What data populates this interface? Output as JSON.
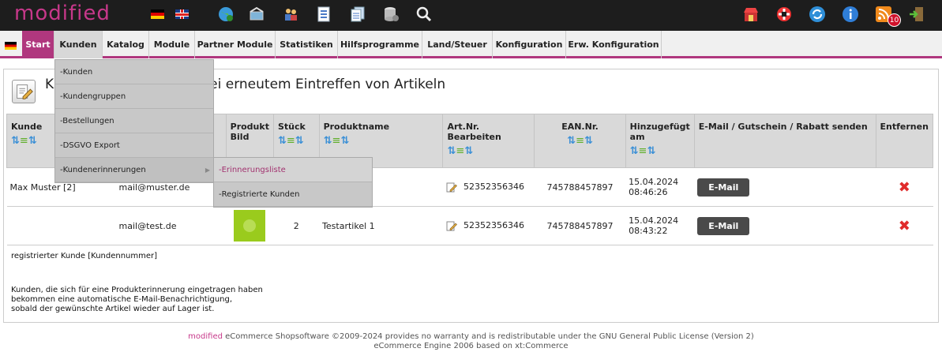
{
  "app": {
    "logo": "modified",
    "notification_count": "10"
  },
  "topbar_icons": [
    "globe-icon",
    "basket-icon",
    "users-icon",
    "checklist-icon",
    "documents-icon",
    "database-icon",
    "search-icon",
    "shop-icon",
    "lifebuoy-icon",
    "refresh-icon",
    "info-icon",
    "rss-icon",
    "logout-icon"
  ],
  "menu": [
    "Start",
    "Kunden",
    "Katalog",
    "Module",
    "Partner Module",
    "Statistiken",
    "Hilfsprogramme",
    "Land/Steuer",
    "Konfiguration",
    "Erw. Konfiguration"
  ],
  "page": {
    "title_visible": "Kunden / Artikel bei erneutem Eintreffen von Artikeln",
    "title_visible_suffix": "ei erneutem Eintreffen von Artikeln",
    "title_prefix": "K"
  },
  "dropdown": [
    "-Kunden",
    "-Kundengruppen",
    "-Bestellungen",
    "-DSGVO Export",
    "-Kundenerinnerungen"
  ],
  "submenu": [
    "-Erinnerungsliste",
    "-Registrierte Kunden"
  ],
  "table": {
    "headers": {
      "kunde": "Kunde",
      "bild": "Produkt Bild",
      "stueck": "Stück",
      "produktname": "Produktname",
      "artnr": "Art.Nr. Bearbeiten",
      "ean": "EAN.Nr.",
      "hinzu": "Hinzugefügt am",
      "email": "E-Mail / Gutschein / Rabatt senden",
      "entfernen": "Entfernen"
    },
    "rows": [
      {
        "kunde": "Max Muster [2]",
        "email": "mail@muster.de",
        "stueck": "",
        "produkt": "",
        "artnr": "52352356346",
        "ean": "745788457897",
        "datum": "15.04.2024",
        "zeit": "08:46:26",
        "button": "E-Mail"
      },
      {
        "kunde": "",
        "email": "mail@test.de",
        "stueck": "2",
        "produkt": "Testartikel 1",
        "artnr": "52352356346",
        "ean": "745788457897",
        "datum": "15.04.2024",
        "zeit": "08:43:22",
        "button": "E-Mail"
      }
    ]
  },
  "legend": "registrierter Kunde [Kundennummer]",
  "info_lines": [
    "Kunden, die sich für eine Produkterinnerung eingetragen haben",
    "bekommen eine automatische E-Mail-Benachrichtigung,",
    "sobald der gewünschte Artikel wieder auf Lager ist."
  ],
  "footer": {
    "brand": "modified",
    "line1": " eCommerce Shopsoftware ©2009-2024 provides no warranty and is redistributable under the GNU General Public License (Version 2)",
    "line2": "eCommerce Engine 2006 based on xt:Commerce"
  }
}
